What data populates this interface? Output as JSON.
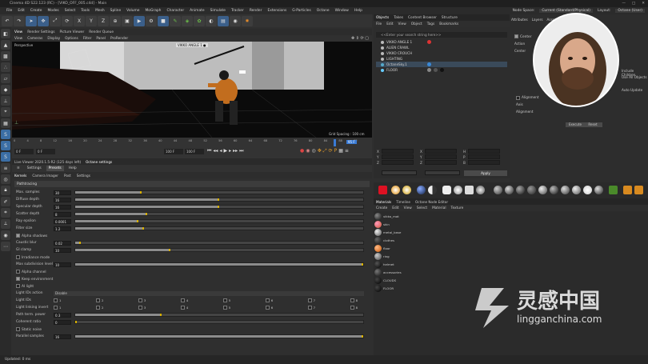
{
  "window": {
    "title": "Cinema 4D S22.123 (RC) - [VIKO_OFF_005.c4d] - Main",
    "controls": [
      "—",
      "□",
      "✕"
    ]
  },
  "menubar": {
    "items": [
      "File",
      "Edit",
      "Create",
      "Modes",
      "Select",
      "Tools",
      "Mesh",
      "Spline",
      "Volume",
      "MoGraph",
      "Character",
      "Animate",
      "Simulate",
      "Tracker",
      "Render",
      "Extensions",
      "G-Particles",
      "Octane",
      "Window",
      "Help"
    ],
    "node_space_label": "Node Space:",
    "node_space_value": "Current (Standard/Physical)",
    "layout_label": "Layout:",
    "layout_value": "Octane (User)"
  },
  "toolbar": {
    "icons": [
      "undo-icon",
      "redo-icon",
      "select-icon",
      "move-icon",
      "scale-icon",
      "rotate-icon",
      "x-axis-icon",
      "y-axis-icon",
      "z-axis-icon",
      "coord-icon",
      "render-view-icon",
      "render-icon",
      "render-settings-icon",
      "cube-icon",
      "pen-icon",
      "subdivision-icon",
      "cloner-icon",
      "deformer-icon",
      "floor-icon",
      "camera-icon",
      "light-icon"
    ],
    "axis_labels": [
      "X",
      "Y",
      "Z"
    ]
  },
  "viewport": {
    "tabs": [
      "View",
      "Render Settings",
      "Picture Viewer",
      "Render Queue"
    ],
    "menu": [
      "View",
      "Cameras",
      "Display",
      "Options",
      "Filter",
      "Panel",
      "ProRender"
    ],
    "name": "Perspective",
    "camera_tag": "VIKKO ANGLE 1 ●",
    "grid_spacing": "Grid Spacing : 100 cm"
  },
  "timeline": {
    "ticks": [
      "0",
      "2",
      "4",
      "6",
      "8",
      "10",
      "12",
      "14",
      "16",
      "18",
      "20",
      "22",
      "24",
      "26",
      "28",
      "30",
      "32",
      "34",
      "36",
      "38",
      "40",
      "42",
      "44",
      "46",
      "48",
      "50",
      "52",
      "54",
      "56",
      "58",
      "60",
      "62",
      "64",
      "66",
      "68",
      "70",
      "72",
      "74",
      "76",
      "78",
      "80",
      "82",
      "84",
      "86",
      "88",
      "90",
      "92",
      "94"
    ],
    "current_frame": "0 F",
    "start_frame": "0 F",
    "end_frame": "100 F",
    "end_frame2": "100 F",
    "frame_readout": "95 F"
  },
  "octane": {
    "header": "Live Viewer 2020.1.5-R2 (125 days left)",
    "header_tab": "Octane settings",
    "tabs": [
      "Settings",
      "Presets",
      "Help"
    ],
    "active_tab": "Presets",
    "subtabs": [
      "Kernels",
      "Camera Imager",
      "Post",
      "Settings"
    ],
    "kernel_section": "Pathtracing",
    "rows": [
      {
        "label": "Max. samples",
        "value": "30",
        "fill": 0.23
      },
      {
        "label": "Diffuse depth",
        "value": "16",
        "fill": 0.5
      },
      {
        "label": "Specular depth",
        "value": "16",
        "fill": 0.5
      },
      {
        "label": "Scatter depth",
        "value": "8",
        "fill": 0.25
      },
      {
        "label": "Ray epsilon",
        "value": "0.0001",
        "fill": 0.22
      },
      {
        "label": "Filter size",
        "value": "1.2",
        "fill": 0.24
      }
    ],
    "alpha_shadows": "Alpha shadows",
    "caustic_blur": {
      "label": "Caustic blur",
      "value": "0.02",
      "fill": 0.02
    },
    "gi_clamp": {
      "label": "GI clamp",
      "value": "10",
      "fill": 0.33
    },
    "irradiance_mode": "Irradiance mode",
    "nested_dielectric": {
      "label": "Max subdivision level",
      "value": "10",
      "fill": 1.0
    },
    "alpha_channel": "Alpha channel",
    "keep_environment": "Keep environment",
    "ai_light": "AI light",
    "light_ids_action_label": "Light IDs action",
    "light_ids_action_value": "Disable",
    "light_ids_label": "Light IDs",
    "light_linking_label": "Light linking invert",
    "light_id_nums": [
      "1",
      "2",
      "3",
      "4",
      "5",
      "6",
      "7",
      "8"
    ],
    "path_term": {
      "label": "Path term. power",
      "value": "0.3",
      "fill": 0.3
    },
    "coherent_ratio": {
      "label": "Coherent ratio",
      "value": "0",
      "fill": 0.0
    },
    "static_noise": "Static noise",
    "parallel_samples": {
      "label": "Parallel samples",
      "value": "16",
      "fill": 1.0
    }
  },
  "objects": {
    "tabs": [
      "Objects",
      "Takes",
      "Content Browser",
      "Structure"
    ],
    "menu": [
      "File",
      "Edit",
      "View",
      "Object",
      "Tags",
      "Bookmarks"
    ],
    "search_placeholder": "<<Enter your search string here>>",
    "items": [
      "VIKKO ANGLE 1",
      "ALIEN CRAWL",
      "VIKKO CROUCH",
      "LIGHTING",
      "OctaneSky.1",
      "FLOOR"
    ]
  },
  "attributes": {
    "size_labels": [
      "X",
      "Y",
      "Z"
    ],
    "size_values": [
      "0 cm",
      "0 cm",
      "0 cm"
    ],
    "pos_labels": [
      "H",
      "P",
      "B"
    ],
    "pos_values": [
      "0°",
      "0°",
      "0°"
    ],
    "world_label": "World",
    "scale_label": "Size",
    "apply": "Apply"
  },
  "right_panel": {
    "tabs": [
      "Attributes",
      "Layers",
      "Asset"
    ],
    "center_label": "Center",
    "action_label": "Action",
    "action_value": "Set",
    "center_field": "Center",
    "auto_update": "Auto Update",
    "alignment": "Alignment",
    "axis_label": "Axis",
    "axis_value": "+X",
    "alignment_label": "Alignment",
    "alignment_value": "Center",
    "include_children": "Include Children",
    "use_all_objects": "Use All Objects",
    "execute": "Execute",
    "reset": "Reset"
  },
  "materials": {
    "tabs": [
      "Materials",
      "Timeline",
      "Octane Node Editor"
    ],
    "menu": [
      "Create",
      "Edit",
      "View",
      "Select",
      "Material",
      "Texture"
    ],
    "items": [
      "vikko_mat",
      "skin",
      "metal_base",
      "clothes",
      "floor",
      "ring",
      "helmet",
      "accessories",
      "CLOUDS",
      "FLOOR"
    ]
  },
  "status": "Updated: 0 ms",
  "watermark": {
    "brand": "灵感中国",
    "url": "lingganchina.com"
  }
}
